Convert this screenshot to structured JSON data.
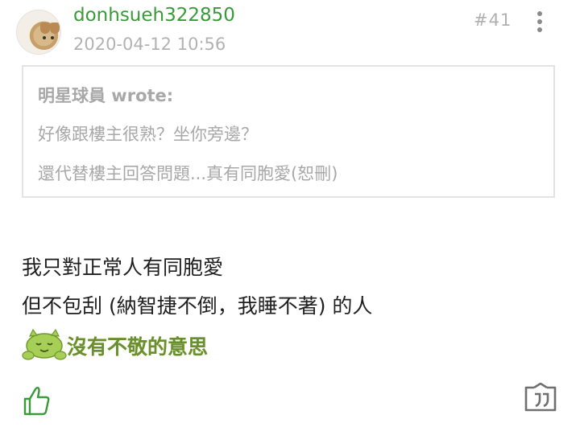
{
  "post": {
    "username": "donhsueh322850",
    "timestamp": "2020-04-12 10:56",
    "floor": "#41",
    "quote": {
      "author": "明星球員 wrote:",
      "lines": [
        "好像跟樓主很熟？坐你旁邊？",
        "還代替樓主回答問題...真有同胞愛(恕刪)"
      ]
    },
    "body_lines": [
      "我只對正常人有同胞愛",
      "但不包刮 (納智捷不倒，我睡不著) 的人"
    ],
    "sticker_text": "沒有不敬的意思"
  },
  "colors": {
    "username": "#3a9a3a",
    "accent": "#3a9a3a",
    "muted": "#b2b2b2"
  },
  "icons": {
    "more": "more-vertical-icon",
    "like": "thumbs-up-icon",
    "quote": "quote-reply-icon"
  }
}
